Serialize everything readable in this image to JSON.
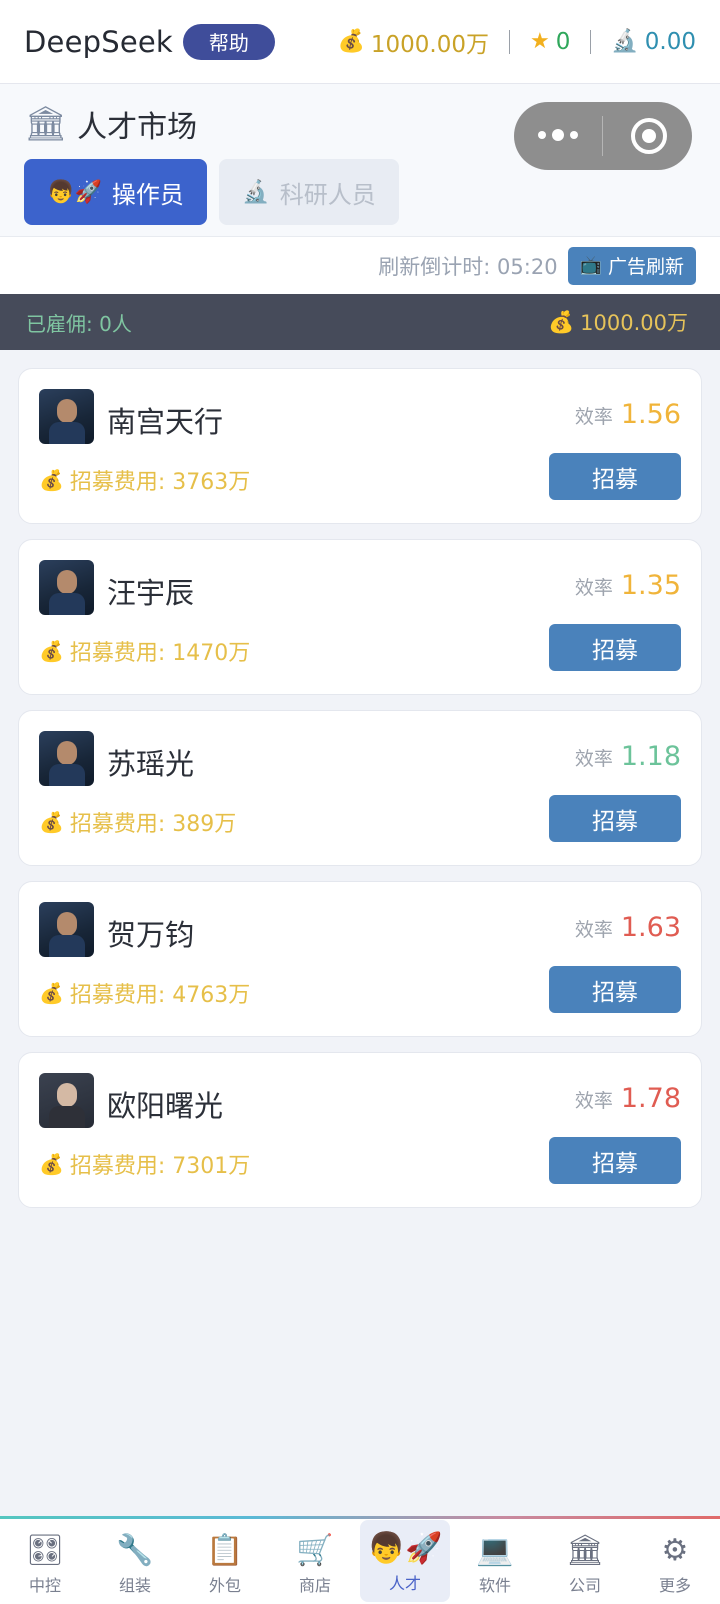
{
  "header": {
    "app_name": "DeepSeek",
    "help_label": "帮助",
    "money": "1000.00万",
    "stars": "0",
    "research": "0.00",
    "icons": {
      "money": "money-bag-icon",
      "star": "star-icon",
      "research": "microscope-icon"
    }
  },
  "market": {
    "title": "人才市场",
    "title_icon": "building-icon",
    "tabs": [
      {
        "label": "操作员",
        "icon": "worker-rocket-icon",
        "active": true
      },
      {
        "label": "科研人员",
        "icon": "microscope-icon",
        "active": false
      }
    ],
    "countdown": "刷新倒计时: 05:20",
    "ad_refresh_label": "广告刷新",
    "hired": "已雇佣: 0人",
    "balance": "1000.00万"
  },
  "labels": {
    "efficiency": "效率",
    "recruit": "招募"
  },
  "candidates": [
    {
      "name": "南宫天行",
      "efficiency": "1.56",
      "eff_color": "#f0b43a",
      "fee": "招募费用: 3763万",
      "avatar": "pilot"
    },
    {
      "name": "汪宇辰",
      "efficiency": "1.35",
      "eff_color": "#f0b43a",
      "fee": "招募费用: 1470万",
      "avatar": "pilot"
    },
    {
      "name": "苏瑶光",
      "efficiency": "1.18",
      "eff_color": "#6cc39a",
      "fee": "招募费用: 389万",
      "avatar": "pilot"
    },
    {
      "name": "贺万钧",
      "efficiency": "1.63",
      "eff_color": "#e05c52",
      "fee": "招募费用: 4763万",
      "avatar": "pilot"
    },
    {
      "name": "欧阳曙光",
      "efficiency": "1.78",
      "eff_color": "#e05c52",
      "fee": "招募费用: 7301万",
      "avatar": "elder"
    }
  ],
  "bottom_nav": [
    {
      "label": "中控",
      "icon": "control-panel-icon",
      "active": false
    },
    {
      "label": "组装",
      "icon": "wrench-icon",
      "active": false
    },
    {
      "label": "外包",
      "icon": "clipboard-icon",
      "active": false
    },
    {
      "label": "商店",
      "icon": "cart-icon",
      "active": false
    },
    {
      "label": "人才",
      "icon": "worker-rocket-icon",
      "active": true
    },
    {
      "label": "软件",
      "icon": "laptop-icon",
      "active": false
    },
    {
      "label": "公司",
      "icon": "building-icon",
      "active": false
    },
    {
      "label": "更多",
      "icon": "gear-icon",
      "active": false
    }
  ]
}
